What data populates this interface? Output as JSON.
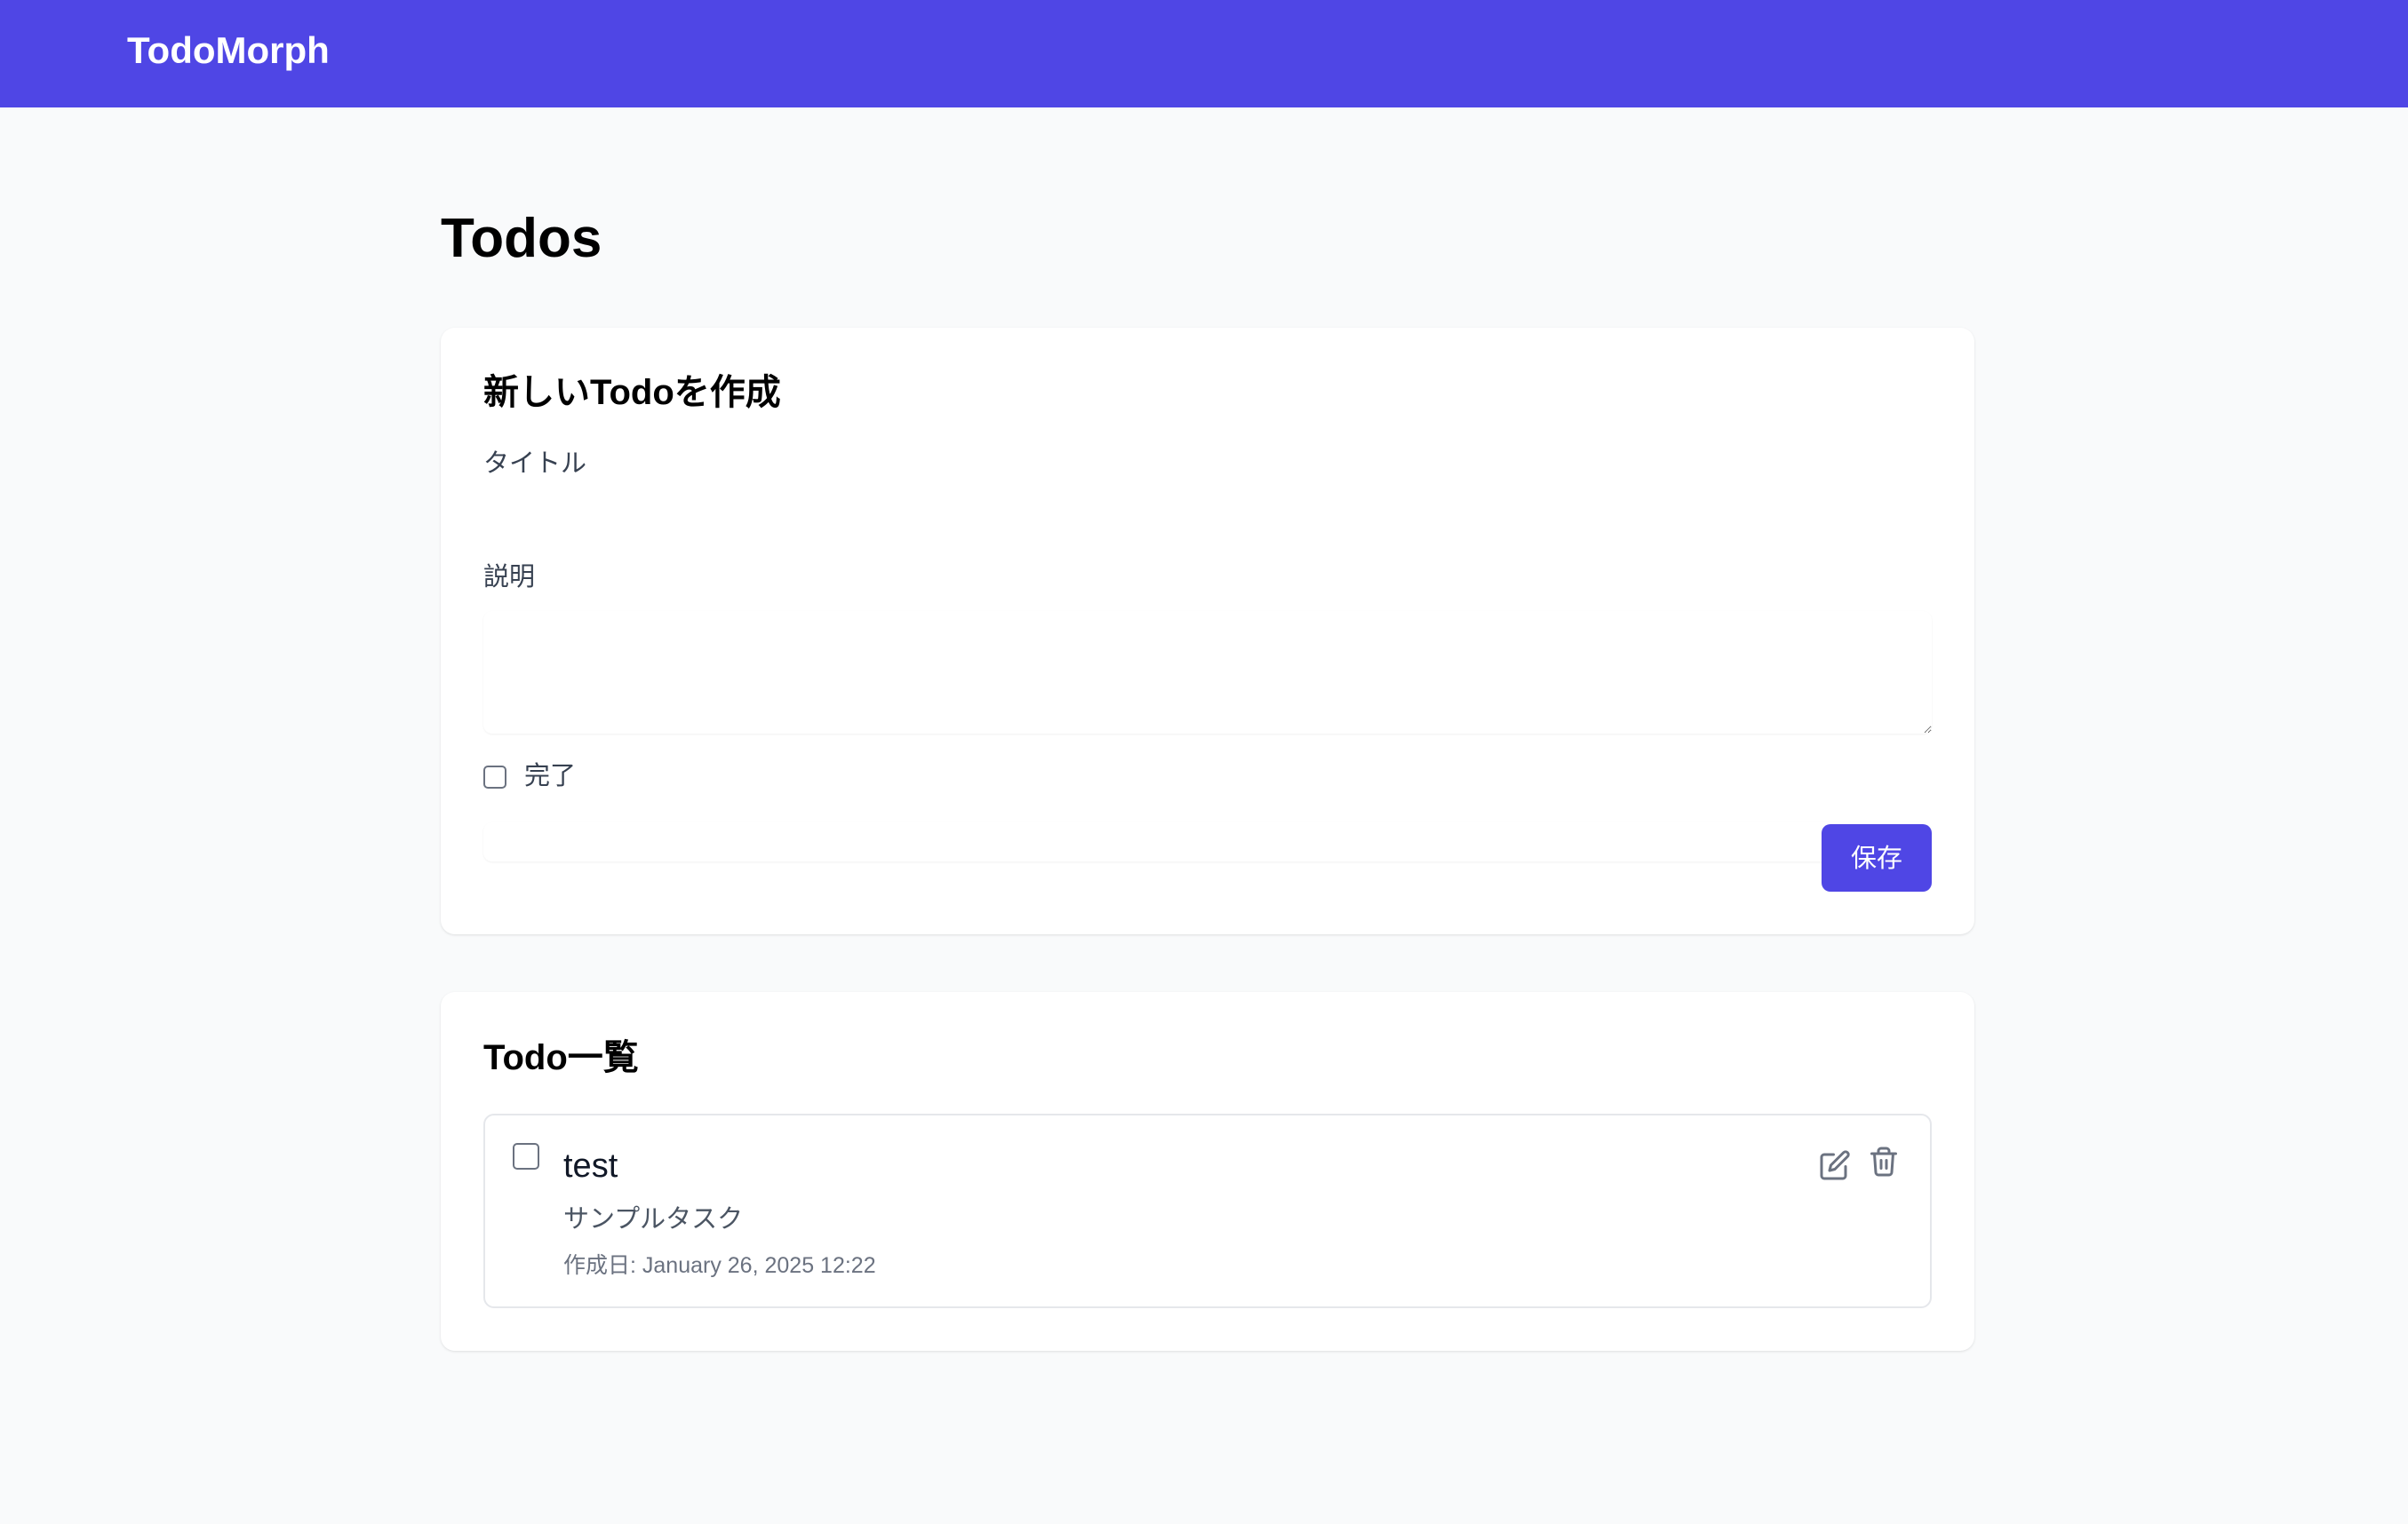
{
  "header": {
    "brand": "TodoMorph"
  },
  "page": {
    "title": "Todos"
  },
  "create_form": {
    "title": "新しいTodoを作成",
    "title_label": "タイトル",
    "title_value": "",
    "description_label": "説明",
    "description_value": "",
    "completed_label": "完了",
    "completed": false,
    "save_label": "保存"
  },
  "todo_list": {
    "title": "Todo一覧",
    "items": [
      {
        "title": "test",
        "description": "サンプルタスク",
        "created": "作成日: January 26, 2025 12:22",
        "completed": false,
        "edit_icon": "edit-icon",
        "delete_icon": "trash-icon"
      }
    ]
  },
  "colors": {
    "primary": "#4f46e5",
    "background": "#f9fafb",
    "card": "#ffffff",
    "icon": "#6b7280"
  }
}
